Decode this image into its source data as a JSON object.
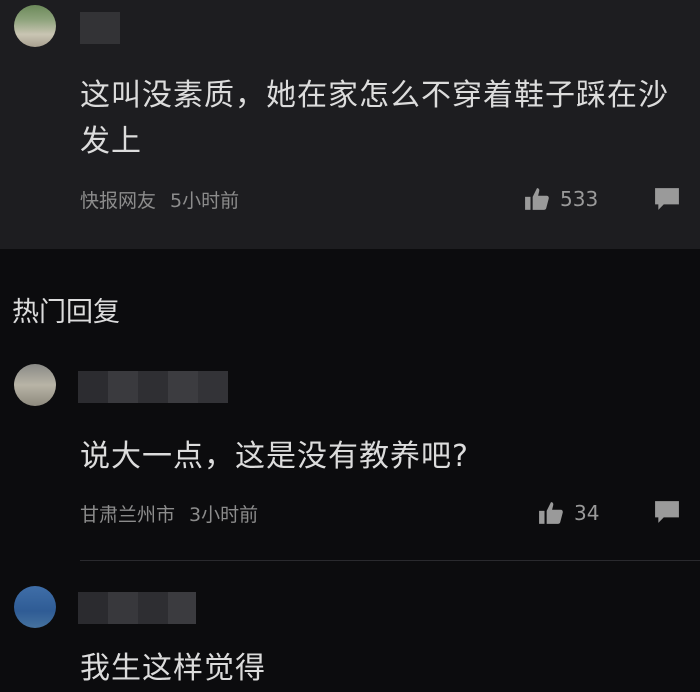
{
  "comments": [
    {
      "text_line1": "这叫没素质，她在家怎么不穿着鞋子踩在沙",
      "text_line2": "发上",
      "location": "快报网友",
      "time": "5小时前",
      "likes": "533"
    }
  ],
  "hot_replies": {
    "title": "热门回复",
    "items": [
      {
        "text": "说大一点，这是没有教养吧?",
        "location": "甘肃兰州市",
        "time": "3小时前",
        "likes": "34"
      },
      {
        "text_partial": "我生这样觉得"
      }
    ]
  },
  "colors": {
    "card_bg": "#1d1d20",
    "page_bg": "#0c0c0e",
    "text": "#dcdcdc",
    "meta": "#8c8c8c"
  }
}
